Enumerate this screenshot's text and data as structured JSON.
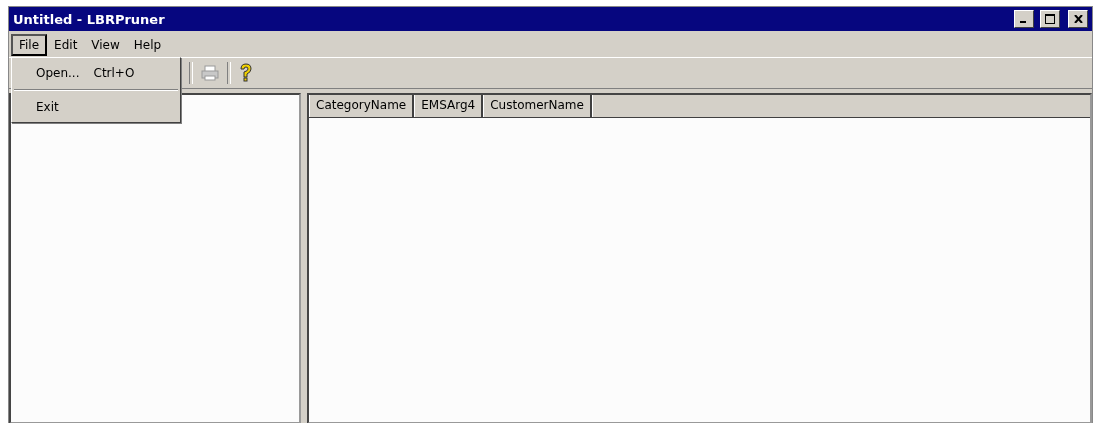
{
  "window": {
    "title": "Untitled - LBRPruner"
  },
  "menu_bar": [
    {
      "label": "File",
      "selected": true
    },
    {
      "label": "Edit",
      "selected": false
    },
    {
      "label": "View",
      "selected": false
    },
    {
      "label": "Help",
      "selected": false
    }
  ],
  "file_menu": [
    {
      "kind": "item",
      "label": "Open...",
      "shortcut": "Ctrl+O"
    },
    {
      "kind": "separator"
    },
    {
      "kind": "item",
      "label": "Exit"
    }
  ],
  "toolbar": [
    {
      "kind": "printer",
      "disabled": true
    },
    {
      "kind": "help",
      "disabled": false
    }
  ],
  "table": {
    "columns": [
      "CategoryName",
      "EMSArg4",
      "CustomerName"
    ]
  }
}
